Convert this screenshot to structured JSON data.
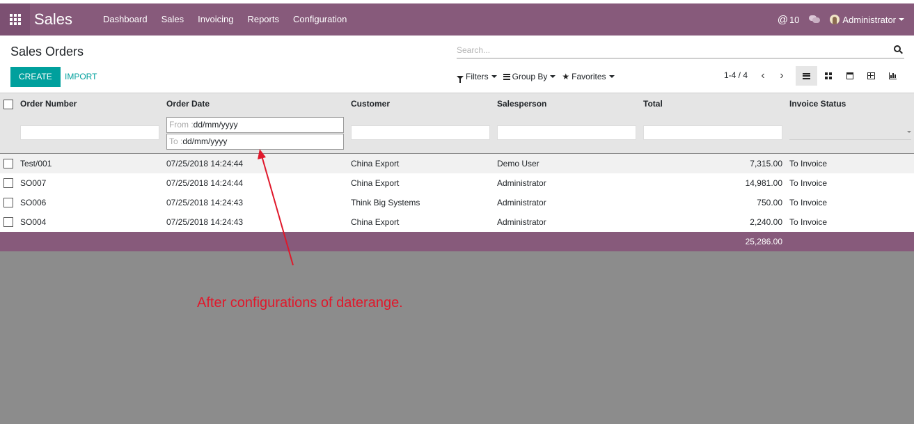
{
  "navbar": {
    "brand": "Sales",
    "menu": [
      "Dashboard",
      "Sales",
      "Invoicing",
      "Reports",
      "Configuration"
    ],
    "mentions": "10",
    "user": "Administrator",
    "color": "#875a7b"
  },
  "control": {
    "title": "Sales Orders",
    "create_label": "CREATE",
    "import_label": "IMPORT",
    "search_placeholder": "Search...",
    "filters_label": "Filters",
    "groupby_label": "Group By",
    "favorites_label": "Favorites",
    "pager": "1-4 / 4",
    "accent": "#00a09d"
  },
  "table": {
    "headers": {
      "order_number": "Order Number",
      "order_date": "Order Date",
      "customer": "Customer",
      "salesperson": "Salesperson",
      "total": "Total",
      "invoice_status": "Invoice Status"
    },
    "date_filter": {
      "from_label": "From :",
      "from_value": "dd/mm/yyyy",
      "to_label": "To :",
      "to_value": "dd/mm/yyyy"
    },
    "rows": [
      {
        "number": "Test/001",
        "date": "07/25/2018 14:24:44",
        "customer": "China Export",
        "salesperson": "Demo User",
        "total": "7,315.00",
        "status": "To Invoice"
      },
      {
        "number": "SO007",
        "date": "07/25/2018 14:24:44",
        "customer": "China Export",
        "salesperson": "Administrator",
        "total": "14,981.00",
        "status": "To Invoice"
      },
      {
        "number": "SO006",
        "date": "07/25/2018 14:24:43",
        "customer": "Think Big Systems",
        "salesperson": "Administrator",
        "total": "750.00",
        "status": "To Invoice"
      },
      {
        "number": "SO004",
        "date": "07/25/2018 14:24:43",
        "customer": "China Export",
        "salesperson": "Administrator",
        "total": "2,240.00",
        "status": "To Invoice"
      }
    ],
    "grand_total": "25,286.00"
  },
  "annotation": {
    "text": "After configurations of daterange.",
    "color": "#e0182b"
  }
}
